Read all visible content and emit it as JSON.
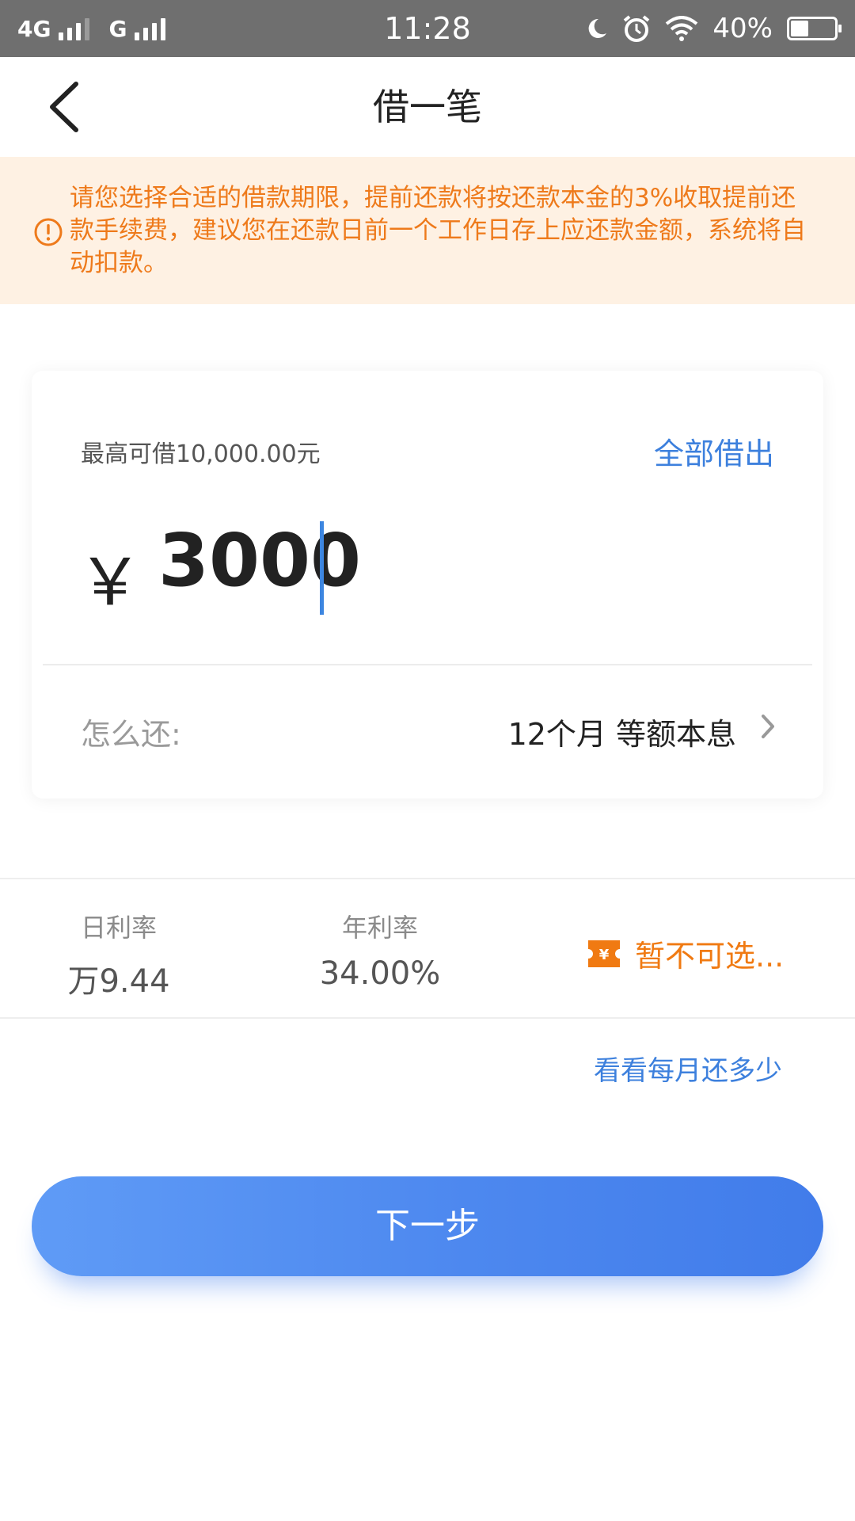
{
  "status_bar": {
    "network_1": "4G",
    "network_2": "G",
    "time": "11:28",
    "battery_text": "40%",
    "battery_level": 0.4
  },
  "header": {
    "title": "借一笔"
  },
  "notice": {
    "text": "请您选择合适的借款期限，提前还款将按还款本金的3%收取提前还款手续费，建议您在还款日前一个工作日存上应还款金额，系统将自动扣款。",
    "color": "#ee7a1b",
    "background": "#fef1e3"
  },
  "loan": {
    "max_label": "最高可借10,000.00元",
    "borrow_all_label": "全部借出",
    "currency_symbol": "￥",
    "amount": "3000",
    "repay_label": "怎么还:",
    "repay_value": "12个月 等额本息"
  },
  "rates": {
    "daily_label": "日利率",
    "daily_value": "万9.44",
    "annual_label": "年利率",
    "annual_value": "34.00%",
    "coupon_text": "暂不可选..."
  },
  "monthly_link": "看看每月还多少",
  "next_button": "下一步",
  "colors": {
    "accent_blue": "#3d80dd",
    "coupon_orange": "#f07a12"
  }
}
